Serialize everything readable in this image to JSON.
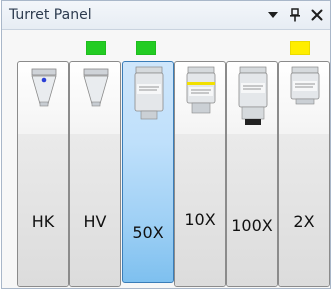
{
  "panel": {
    "title": "Turret Panel",
    "controls": [
      {
        "name": "dropdown-icon"
      },
      {
        "name": "pin-icon"
      },
      {
        "name": "close-icon"
      }
    ]
  },
  "turret": {
    "selected_index": 2,
    "slots": [
      {
        "label": "HK",
        "indicator": null,
        "objective": "cone-with-dot"
      },
      {
        "label": "HV",
        "indicator": "#22cc22",
        "objective": "cone"
      },
      {
        "label": "50X",
        "indicator": "#22cc22",
        "objective": "lens"
      },
      {
        "label": "10X",
        "indicator": null,
        "objective": "lens-yellow-band"
      },
      {
        "label": "100X",
        "indicator": null,
        "objective": "lens-long"
      },
      {
        "label": "2X",
        "indicator": "#ffee00",
        "objective": "lens-short"
      }
    ]
  },
  "colors": {
    "accent": "#3a7db8",
    "green_indicator": "#22cc22",
    "yellow_indicator": "#ffee00"
  }
}
